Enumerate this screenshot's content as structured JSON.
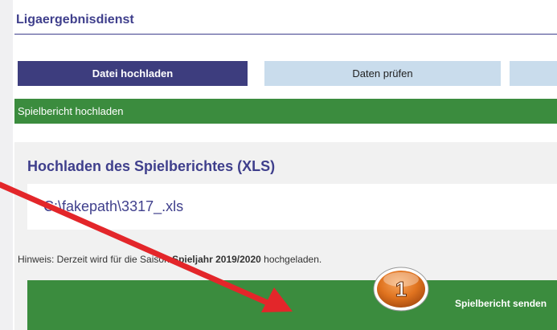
{
  "header": {
    "title": "Ligaergebnisdienst"
  },
  "steps": [
    {
      "label": "Datei hochladen"
    },
    {
      "label": "Daten prüfen"
    },
    {
      "label": ""
    }
  ],
  "section": {
    "bar_label": "Spielbericht hochladen"
  },
  "upload": {
    "heading": "Hochladen des Spielberichtes (XLS)",
    "file_value": "C:\\fakepath\\3317_.xls",
    "hint_prefix": "Hinweis: Derzeit wird für die Saison ",
    "hint_season": "Spieljahr 2019/2020",
    "hint_suffix": " hochgeladen."
  },
  "send_button": {
    "label": "Spielbericht senden"
  },
  "annotation": {
    "badge_number": "1",
    "accent_color": "#e3262a",
    "badge_color": "#e0731f"
  },
  "colors": {
    "brand_blue": "#3f3f8c",
    "step_active": "#3d3d7e",
    "step_inactive": "#c9dcec",
    "green": "#3b8c3e"
  }
}
